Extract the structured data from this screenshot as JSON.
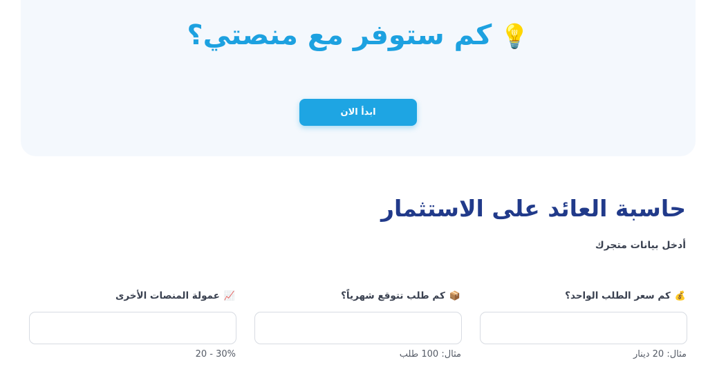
{
  "hero": {
    "title": "كم ستوفر مع منصتي؟",
    "title_icon": "light-bulb-icon",
    "cta_label": "ابدأ الان",
    "accent_color": "#1da1e0"
  },
  "calculator": {
    "title": "حاسبة العائد على الاستثمار",
    "subtitle": "أدخل بيانات متجرك",
    "title_color": "#213a8a",
    "fields": [
      {
        "icon": "money-bag-icon",
        "emoji": "💰",
        "label": "كم سعر الطلب الواحد؟",
        "value": "",
        "hint": "مثال: 20 دينار"
      },
      {
        "icon": "package-icon",
        "emoji": "📦",
        "label": "كم طلب تتوقع شهرياً؟",
        "value": "",
        "hint": "مثال: 100 طلب"
      },
      {
        "icon": "chart-increasing-icon",
        "emoji": "📈",
        "label": "عمولة المنصات الأخرى",
        "value": "",
        "hint": "20 - 30%"
      }
    ]
  }
}
